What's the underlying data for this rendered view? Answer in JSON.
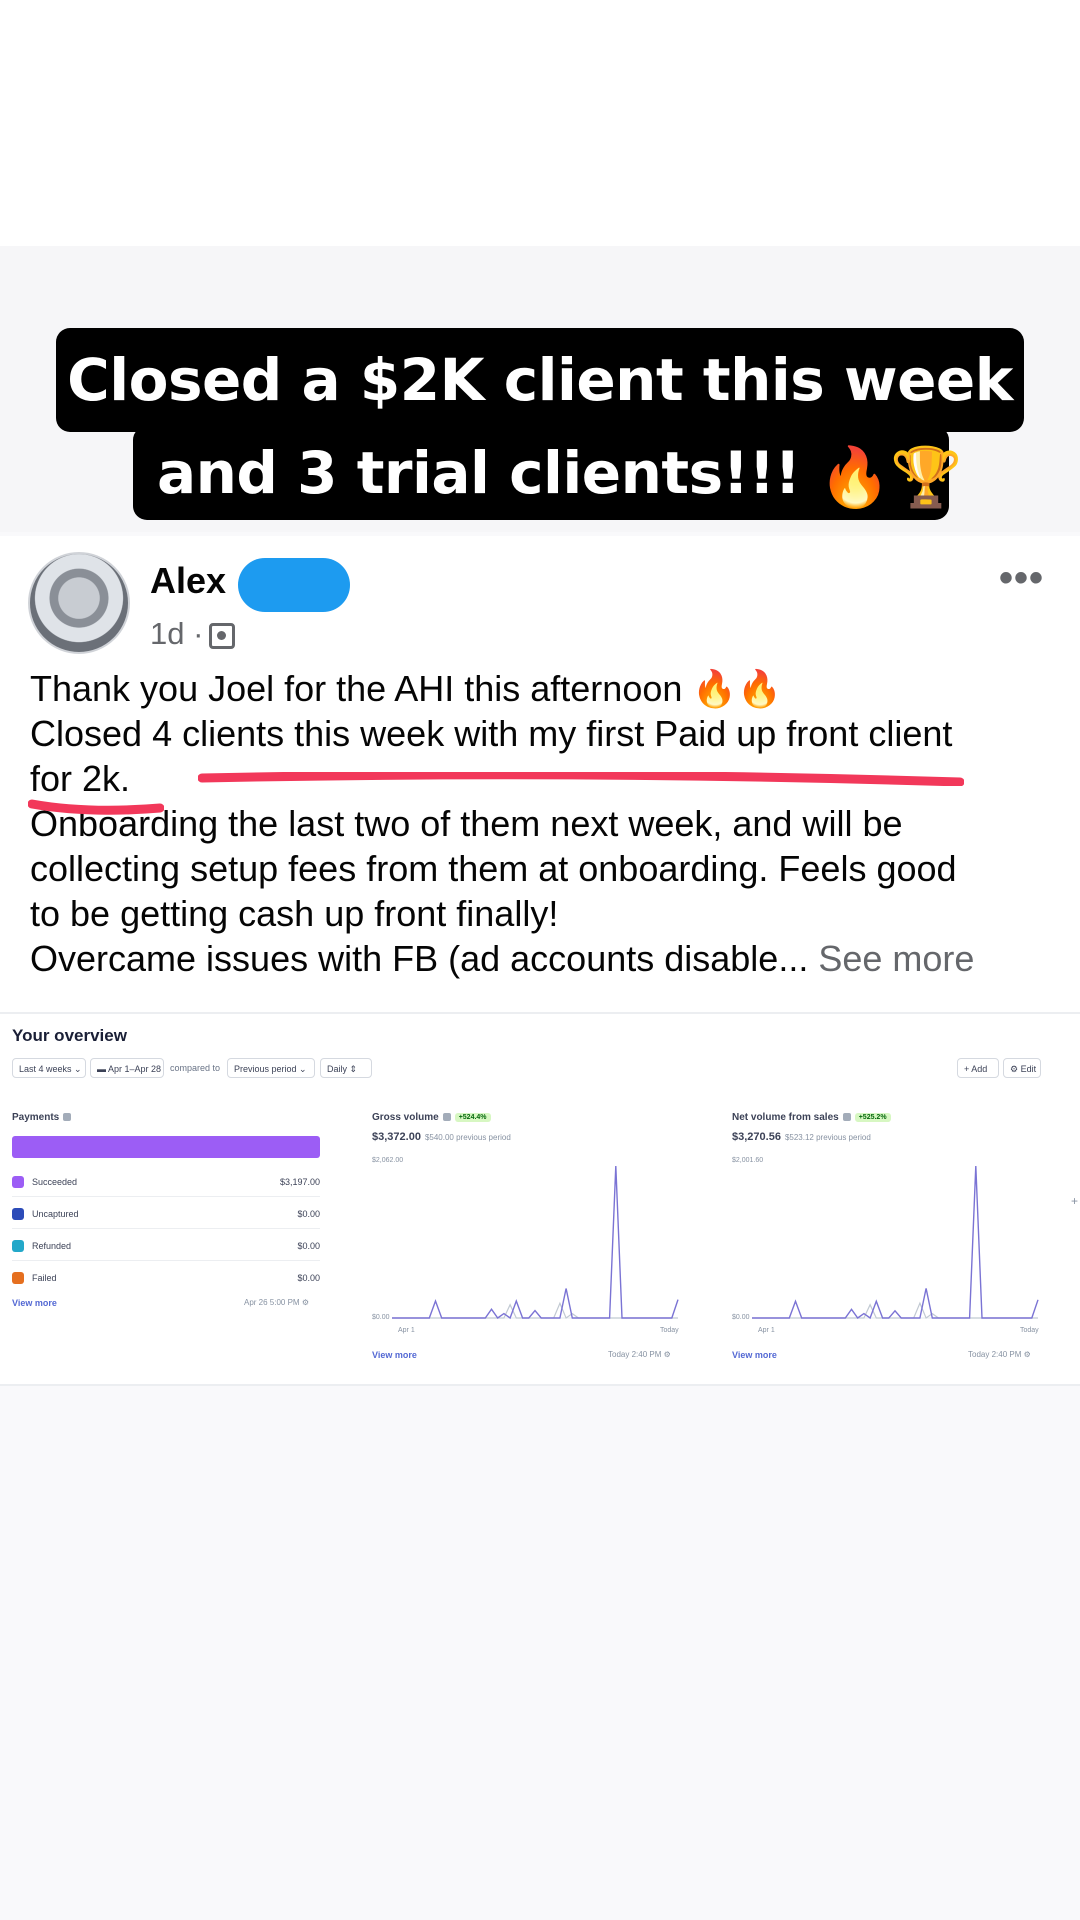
{
  "caption": {
    "line1": "Closed a $2K client this week",
    "line2": "and 3 trial clients!!!",
    "emoji": "🔥🏆"
  },
  "post": {
    "author": "Alex",
    "time": "1d ·",
    "more_icon": "•••",
    "lines": [
      "Thank you Joel for the AHI this afternoon 🔥🔥",
      "Closed 4 clients this week with my first Paid up front client",
      "for 2k.",
      "Onboarding the last two of them next week, and will be",
      "collecting setup fees from them at onboarding. Feels good",
      "to be getting cash up front finally!",
      "Overcame issues with FB (ad accounts disable..."
    ],
    "see_more": "See more",
    "highlight_color": "#f2385a"
  },
  "dashboard": {
    "title": "Your overview",
    "range_select": "Last 4 weeks",
    "date_range": "Apr 1–Apr 28",
    "compared_to": "compared to",
    "compare_select": "Previous period",
    "interval_select": "Daily",
    "add_button": "+ Add",
    "edit_button": "⚙ Edit",
    "payments": {
      "title": "Payments",
      "rows": [
        {
          "label": "Succeeded",
          "value": "$3,197.00",
          "color": "#9c5df5"
        },
        {
          "label": "Uncaptured",
          "value": "$0.00",
          "color": "#2c4bb8"
        },
        {
          "label": "Refunded",
          "value": "$0.00",
          "color": "#23a8c9"
        },
        {
          "label": "Failed",
          "value": "$0.00",
          "color": "#e56f1f"
        }
      ],
      "view_more": "View more",
      "updated": "Apr 26 5:00 PM"
    },
    "gross": {
      "title": "Gross volume",
      "badge": "+524.4%",
      "amount": "$3,372.00",
      "previous": "$540.00 previous period",
      "ymax": "$2,062.00",
      "ymin": "$0.00",
      "x_start": "Apr 1",
      "x_end": "Today",
      "view_more": "View more",
      "updated": "Today 2:40 PM"
    },
    "net": {
      "title": "Net volume from sales",
      "badge": "+525.2%",
      "amount": "$3,270.56",
      "previous": "$523.12 previous period",
      "ymax": "$2,001.60",
      "ymin": "$0.00",
      "x_start": "Apr 1",
      "x_end": "Today",
      "view_more": "View more",
      "updated": "Today 2:40 PM"
    }
  },
  "chart_data": [
    {
      "type": "line",
      "title": "Gross volume",
      "ylim": [
        0,
        2062
      ],
      "series": [
        {
          "values": [
            0,
            0,
            0,
            0,
            0,
            0,
            0,
            230,
            0,
            0,
            0,
            0,
            0,
            0,
            0,
            0,
            120,
            0,
            60,
            0,
            230,
            0,
            0,
            100,
            0,
            0,
            0,
            0,
            400,
            0,
            0,
            0,
            0,
            0,
            0,
            0,
            2062,
            0,
            0,
            0,
            0,
            0,
            0,
            0,
            0,
            0,
            250
          ]
        },
        {
          "values": [
            0,
            0,
            0,
            0,
            0,
            0,
            0,
            0,
            0,
            0,
            0,
            0,
            0,
            0,
            0,
            0,
            0,
            0,
            0,
            180,
            0,
            0,
            0,
            0,
            0,
            0,
            0,
            200,
            0,
            60,
            0,
            0,
            0,
            0,
            0,
            0,
            0,
            0,
            0,
            0,
            0,
            0,
            0,
            0,
            0,
            0,
            0
          ]
        }
      ]
    },
    {
      "type": "line",
      "title": "Net volume from sales",
      "ylim": [
        0,
        2001.6
      ],
      "series": [
        {
          "values": [
            0,
            0,
            0,
            0,
            0,
            0,
            0,
            220,
            0,
            0,
            0,
            0,
            0,
            0,
            0,
            0,
            115,
            0,
            58,
            0,
            220,
            0,
            0,
            95,
            0,
            0,
            0,
            0,
            390,
            0,
            0,
            0,
            0,
            0,
            0,
            0,
            2001.6,
            0,
            0,
            0,
            0,
            0,
            0,
            0,
            0,
            0,
            240
          ]
        },
        {
          "values": [
            0,
            0,
            0,
            0,
            0,
            0,
            0,
            0,
            0,
            0,
            0,
            0,
            0,
            0,
            0,
            0,
            0,
            0,
            0,
            175,
            0,
            0,
            0,
            0,
            0,
            0,
            0,
            195,
            0,
            58,
            0,
            0,
            0,
            0,
            0,
            0,
            0,
            0,
            0,
            0,
            0,
            0,
            0,
            0,
            0,
            0,
            0
          ]
        }
      ]
    }
  ]
}
